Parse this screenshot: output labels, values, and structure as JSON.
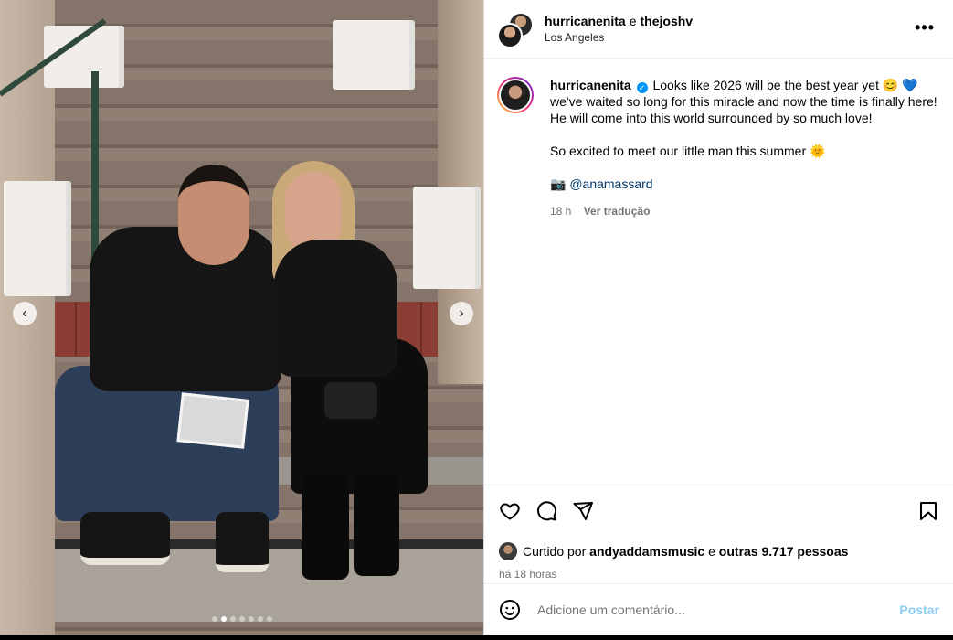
{
  "header": {
    "user1": "hurricanenita",
    "conj": "e",
    "user2": "thejoshv",
    "location": "Los Angeles",
    "more_label": "•••"
  },
  "caption": {
    "username": "hurricanenita",
    "text1": "Looks like 2026 will be the best year yet 😊 💙 we've waited so long for this miracle and now the time is finally here! He will come into this world surrounded by so much love!",
    "text2": "So excited to meet our little man this summer 🌞",
    "camera": "📷",
    "mention": "@anamassard",
    "time": "18 h",
    "translate": "Ver tradução"
  },
  "likes": {
    "prefix": "Curtido por",
    "user": "andyaddamsmusic",
    "joiner": "e",
    "others": "outras 9.717 pessoas",
    "ago": "há 18 horas"
  },
  "comment": {
    "placeholder": "Adicione um comentário...",
    "post_label": "Postar"
  },
  "carousel": {
    "prev": "‹",
    "next": "›"
  },
  "icons": [
    "heart-icon",
    "comment-icon",
    "share-icon",
    "bookmark-icon",
    "emoji-icon",
    "verified-icon"
  ]
}
